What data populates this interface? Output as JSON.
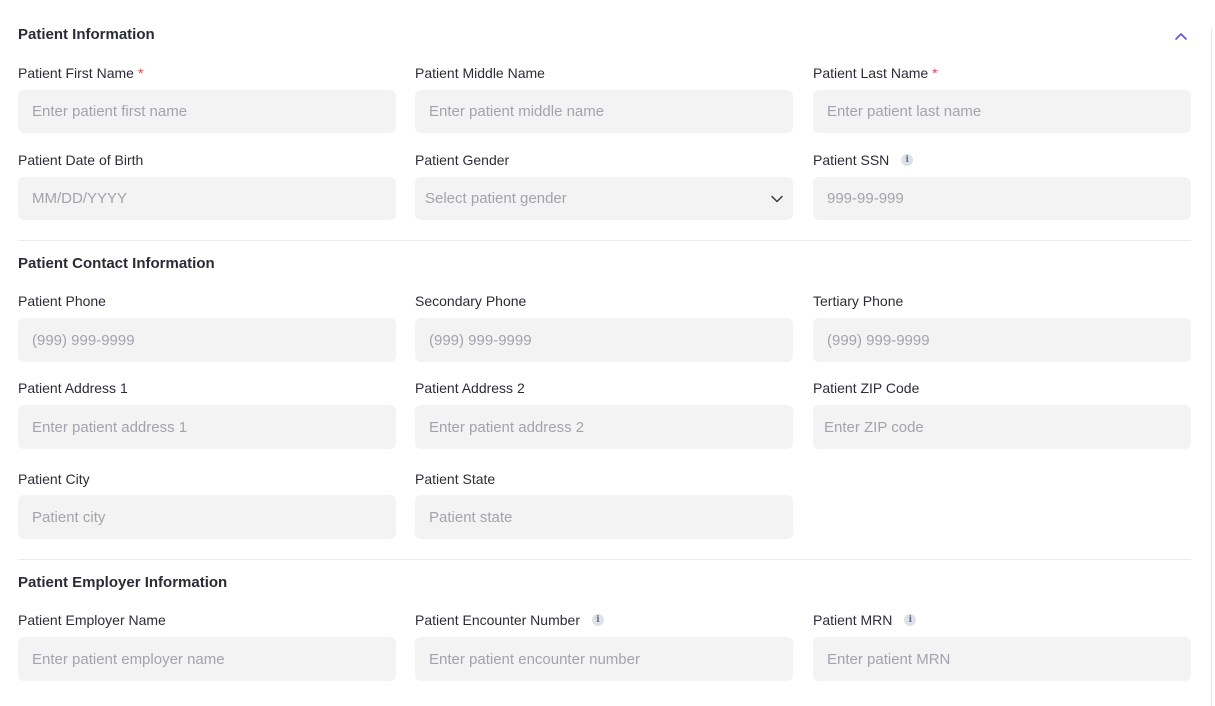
{
  "sections": {
    "patient_info": {
      "title": "Patient Information",
      "first_name": {
        "label": "Patient First Name",
        "required": "*",
        "placeholder": "Enter patient first name"
      },
      "middle_name": {
        "label": "Patient Middle Name",
        "placeholder": "Enter patient middle name"
      },
      "last_name": {
        "label": "Patient Last Name",
        "required": "*",
        "placeholder": "Enter patient last name"
      },
      "dob": {
        "label": "Patient Date of Birth",
        "placeholder": "MM/DD/YYYY"
      },
      "gender": {
        "label": "Patient Gender",
        "placeholder": "Select patient gender"
      },
      "ssn": {
        "label": "Patient SSN",
        "placeholder": "999-99-999"
      }
    },
    "contact_info": {
      "title": "Patient Contact Information",
      "phone": {
        "label": "Patient Phone",
        "placeholder": "(999) 999-9999"
      },
      "secondary_phone": {
        "label": "Secondary Phone",
        "placeholder": "(999) 999-9999"
      },
      "tertiary_phone": {
        "label": "Tertiary Phone",
        "placeholder": "(999) 999-9999"
      },
      "address1": {
        "label": "Patient Address 1",
        "placeholder": "Enter patient address 1"
      },
      "address2": {
        "label": "Patient Address 2",
        "placeholder": "Enter patient address 2"
      },
      "zip": {
        "label": "Patient ZIP Code",
        "placeholder": "Enter ZIP code"
      },
      "city": {
        "label": "Patient City",
        "placeholder": "Patient city"
      },
      "state": {
        "label": "Patient State",
        "placeholder": "Patient state"
      }
    },
    "employer_info": {
      "title": "Patient Employer Information",
      "employer_name": {
        "label": "Patient Employer Name",
        "placeholder": "Enter patient employer name"
      },
      "encounter_number": {
        "label": "Patient Encounter Number",
        "placeholder": "Enter patient encounter number"
      },
      "mrn": {
        "label": "Patient MRN",
        "placeholder": "Enter patient MRN"
      }
    }
  },
  "icons": {
    "collapse": "chevron-up-icon",
    "dropdown": "chevron-down-icon",
    "info": "info-icon",
    "info_glyph": "i"
  },
  "colors": {
    "accent": "#6e4fd8",
    "required": "#e5484d",
    "input_bg": "#f3f3f4",
    "placeholder": "#a3a3ac"
  }
}
